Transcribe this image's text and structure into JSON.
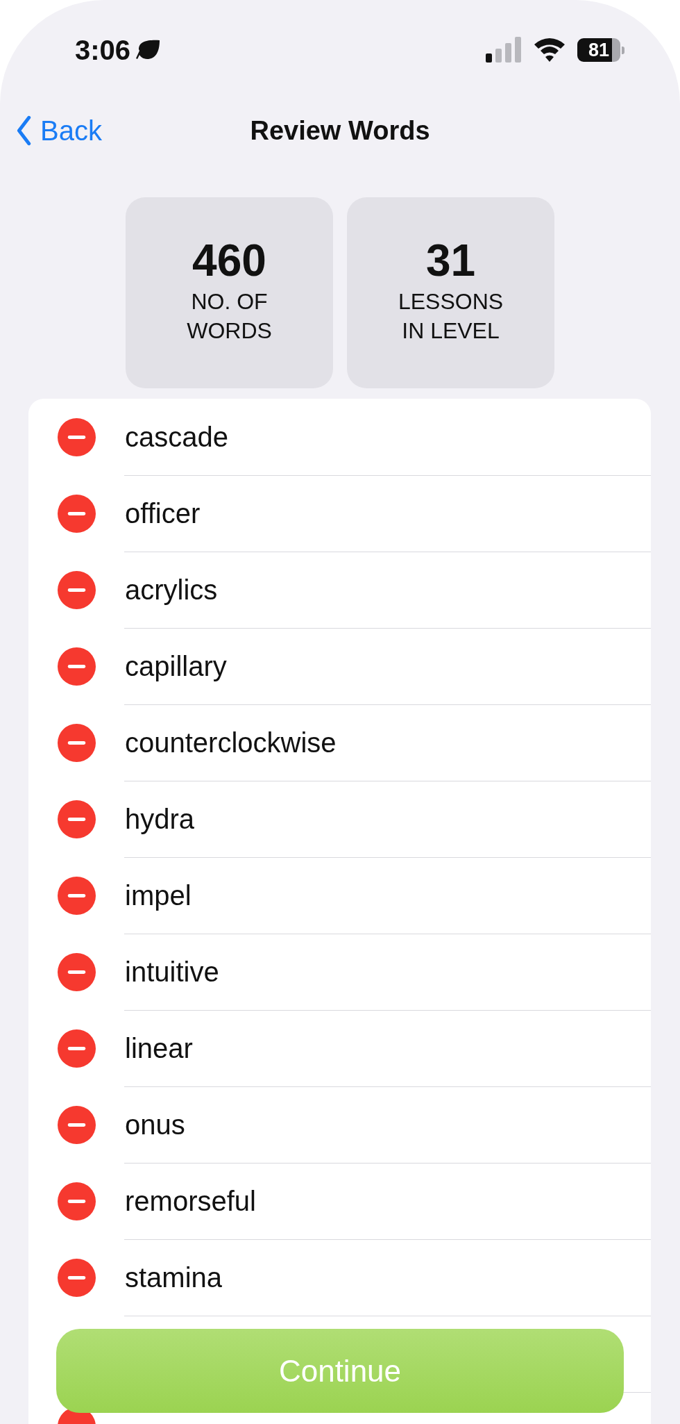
{
  "status_bar": {
    "time": "3:06",
    "battery": "81"
  },
  "nav": {
    "back": "Back",
    "title": "Review Words"
  },
  "stats": [
    {
      "value": "460",
      "label": "NO. OF WORDS"
    },
    {
      "value": "31",
      "label": "LESSONS IN LEVEL"
    }
  ],
  "words": [
    "cascade",
    "officer",
    "acrylics",
    "capillary",
    "counterclockwise",
    "hydra",
    "impel",
    "intuitive",
    "linear",
    "onus",
    "remorseful",
    "stamina"
  ],
  "partial_row": true,
  "button": "Continue"
}
